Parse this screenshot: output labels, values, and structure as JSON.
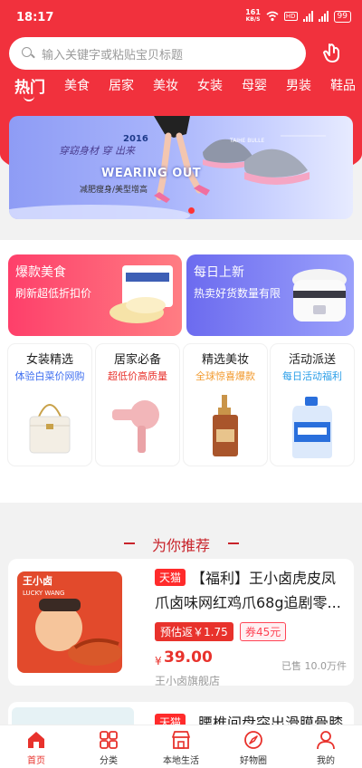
{
  "status_bar": {
    "time": "18:17",
    "speed_top": "161",
    "speed_bottom": "KB/S",
    "hd": "HD",
    "battery": "99"
  },
  "search": {
    "placeholder": "输入关键字或粘贴宝贝标题"
  },
  "category_tabs": [
    "热门",
    "美食",
    "居家",
    "美妆",
    "女装",
    "母婴",
    "男装",
    "鞋品"
  ],
  "banner": {
    "script_text": "穿窈身材 穿 出来",
    "year": "2016",
    "headline": "WEARING OUT",
    "subtext": "减肥瘦身/美型增高",
    "brand": "TAIHE BULLE"
  },
  "promo_cards": [
    {
      "title": "爆款美食",
      "subtitle": "刷新超低折扣价"
    },
    {
      "title": "每日上新",
      "subtitle": "热卖好货数量有限"
    }
  ],
  "mini_cards": [
    {
      "title": "女装精选",
      "subtitle": "体验白菜价网购",
      "color": "#3f6ff0"
    },
    {
      "title": "居家必备",
      "subtitle": "超低价高质量",
      "color": "#e8322c"
    },
    {
      "title": "精选美妆",
      "subtitle": "全球惊喜爆款",
      "color": "#f29a2e"
    },
    {
      "title": "活动派送",
      "subtitle": "每日活动福利",
      "color": "#2a9ee8"
    }
  ],
  "recommend": {
    "title": "为你推荐",
    "product": {
      "badge": "天猫",
      "title": "【福利】王小卤虎皮凤爪卤味网红鸡爪68g追剧零...",
      "rebate_tag": "预估返￥1.75",
      "coupon_tag": "券45元",
      "currency": "¥",
      "price": "39.00",
      "sold": "已售 10.0万件",
      "shop": "王小卤旗舰店",
      "package_brand": "王小卤",
      "package_brand_en": "LUCKY WANG"
    },
    "product_2": {
      "badge": "天猫",
      "title": "腰椎间盘突出滑膜骨膝"
    }
  },
  "bottom_nav": [
    "首页",
    "分类",
    "本地生活",
    "好物圈",
    "我的"
  ],
  "colors": {
    "brand_red": "#f1313d",
    "price_red": "#e8322c"
  }
}
